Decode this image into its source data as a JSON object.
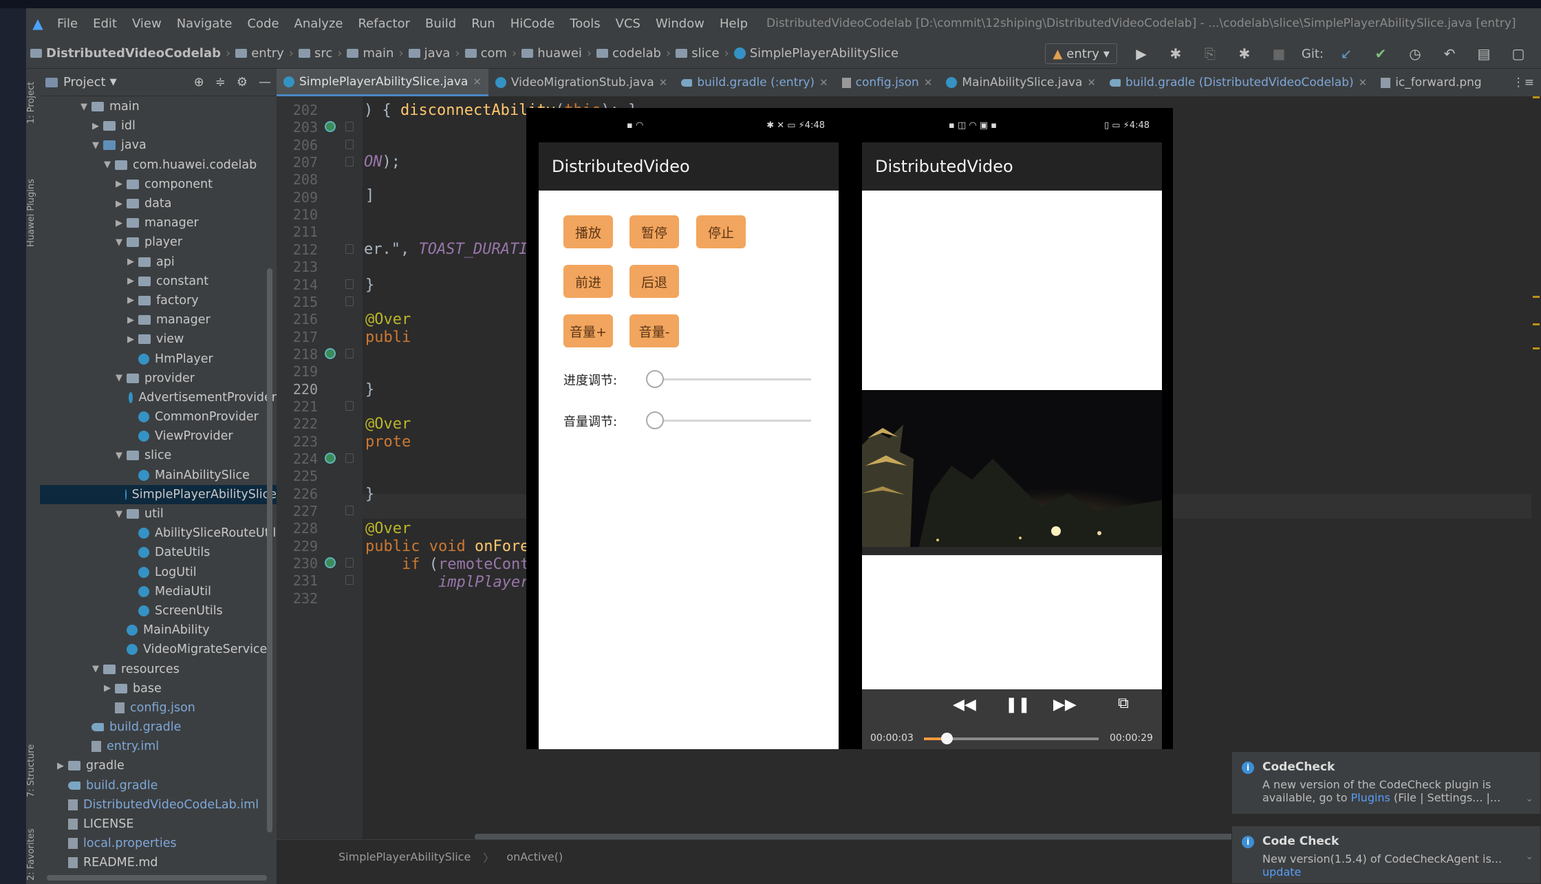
{
  "menubar": {
    "items": [
      "File",
      "Edit",
      "View",
      "Navigate",
      "Code",
      "Analyze",
      "Refactor",
      "Build",
      "Run",
      "HiCode",
      "Tools",
      "VCS",
      "Window",
      "Help"
    ],
    "window_title": "DistributedVideoCodelab [D:\\commit\\12shiping\\DistributedVideoCodelab] - ...\\codelab\\slice\\SimplePlayerAbilitySlice.java [entry]"
  },
  "breadcrumbs": [
    "DistributedVideoCodelab",
    "entry",
    "src",
    "main",
    "java",
    "com",
    "huawei",
    "codelab",
    "slice",
    "SimplePlayerAbilitySlice"
  ],
  "toolbar": {
    "run_config": "entry",
    "git_label": "Git:"
  },
  "left_toolwindow": {
    "project": "1: Project",
    "plugins": "Huawei Plugins",
    "structure": "7: Structure",
    "favorites": "2: Favorites"
  },
  "project_panel": {
    "title": "Project",
    "tree": [
      {
        "label": "main",
        "depth": 3,
        "type": "folder",
        "expanded": true
      },
      {
        "label": "idl",
        "depth": 4,
        "type": "folder",
        "expanded": false
      },
      {
        "label": "java",
        "depth": 4,
        "type": "folder-blue",
        "expanded": true
      },
      {
        "label": "com.huawei.codelab",
        "depth": 5,
        "type": "folder",
        "expanded": true
      },
      {
        "label": "component",
        "depth": 6,
        "type": "folder",
        "expanded": false
      },
      {
        "label": "data",
        "depth": 6,
        "type": "folder",
        "expanded": false
      },
      {
        "label": "manager",
        "depth": 6,
        "type": "folder",
        "expanded": false
      },
      {
        "label": "player",
        "depth": 6,
        "type": "folder",
        "expanded": true
      },
      {
        "label": "api",
        "depth": 7,
        "type": "folder",
        "expanded": false
      },
      {
        "label": "constant",
        "depth": 7,
        "type": "folder",
        "expanded": false
      },
      {
        "label": "factory",
        "depth": 7,
        "type": "folder",
        "expanded": false
      },
      {
        "label": "manager",
        "depth": 7,
        "type": "folder",
        "expanded": false
      },
      {
        "label": "view",
        "depth": 7,
        "type": "folder",
        "expanded": false
      },
      {
        "label": "HmPlayer",
        "depth": 7,
        "type": "class"
      },
      {
        "label": "provider",
        "depth": 6,
        "type": "folder",
        "expanded": true
      },
      {
        "label": "AdvertisementProvider",
        "depth": 7,
        "type": "class"
      },
      {
        "label": "CommonProvider",
        "depth": 7,
        "type": "class"
      },
      {
        "label": "ViewProvider",
        "depth": 7,
        "type": "class"
      },
      {
        "label": "slice",
        "depth": 6,
        "type": "folder",
        "expanded": true
      },
      {
        "label": "MainAbilitySlice",
        "depth": 7,
        "type": "class"
      },
      {
        "label": "SimplePlayerAbilitySlice",
        "depth": 7,
        "type": "class",
        "selected": true
      },
      {
        "label": "util",
        "depth": 6,
        "type": "folder",
        "expanded": true
      },
      {
        "label": "AbilitySliceRouteUtil",
        "depth": 7,
        "type": "class"
      },
      {
        "label": "DateUtils",
        "depth": 7,
        "type": "class"
      },
      {
        "label": "LogUtil",
        "depth": 7,
        "type": "class"
      },
      {
        "label": "MediaUtil",
        "depth": 7,
        "type": "class"
      },
      {
        "label": "ScreenUtils",
        "depth": 7,
        "type": "class"
      },
      {
        "label": "MainAbility",
        "depth": 6,
        "type": "class"
      },
      {
        "label": "VideoMigrateService",
        "depth": 6,
        "type": "class"
      },
      {
        "label": "resources",
        "depth": 4,
        "type": "folder",
        "expanded": true
      },
      {
        "label": "base",
        "depth": 5,
        "type": "folder",
        "expanded": false
      },
      {
        "label": "config.json",
        "depth": 5,
        "type": "file",
        "blue": true
      },
      {
        "label": "build.gradle",
        "depth": 3,
        "type": "gradle",
        "blue": true
      },
      {
        "label": "entry.iml",
        "depth": 3,
        "type": "file",
        "blue": true
      },
      {
        "label": "gradle",
        "depth": 1,
        "type": "folder",
        "expanded": false
      },
      {
        "label": "build.gradle",
        "depth": 1,
        "type": "gradle",
        "blue": true
      },
      {
        "label": "DistributedVideoCodeLab.iml",
        "depth": 1,
        "type": "file",
        "blue": true
      },
      {
        "label": "LICENSE",
        "depth": 1,
        "type": "file"
      },
      {
        "label": "local.properties",
        "depth": 1,
        "type": "file",
        "blue": true
      },
      {
        "label": "README.md",
        "depth": 1,
        "type": "file"
      }
    ]
  },
  "tabs": [
    {
      "label": "SimplePlayerAbilitySlice.java",
      "icon": "class",
      "active": true
    },
    {
      "label": "VideoMigrationStub.java",
      "icon": "class"
    },
    {
      "label": "build.gradle (:entry)",
      "icon": "gradle",
      "colored": true
    },
    {
      "label": "config.json",
      "icon": "json",
      "colored": true
    },
    {
      "label": "MainAbilitySlice.java",
      "icon": "class"
    },
    {
      "label": "build.gradle (DistributedVideoCodelab)",
      "icon": "gradle",
      "colored": true
    },
    {
      "label": "ic_forward.png",
      "icon": "png"
    }
  ],
  "gutter_lines": [
    "202",
    "203",
    "206",
    "207",
    "208",
    "209",
    "210",
    "211",
    "212",
    "213",
    "214",
    "215",
    "216",
    "217",
    "218",
    "219",
    "220",
    "221",
    "222",
    "223",
    "224",
    "225",
    "226",
    "227",
    "228",
    "229",
    "230",
    "231",
    "232"
  ],
  "current_line": "220",
  "code": {
    "l203_tail": ") { disconnectAbility(this); }",
    "l208_tail": "ON);",
    "l213_tail": "er.\", TOAST_DURATION);",
    "l215": "}",
    "l217": "@Over",
    "l218": "publi",
    "l221": "}",
    "l223": "@Over",
    "l224": "prote",
    "l227": "}",
    "l229": "@Over",
    "l230": "public void onForeground(Intent intent) {",
    "l231": "    if (remoteController == null || !remoteController.isShown()) {",
    "l232": "        implPlayer.getLifecycle().onForeground();"
  },
  "statusbar": {
    "class": "SimplePlayerAbilitySlice",
    "method": "onActive()"
  },
  "phone_left": {
    "status_time": "4:48",
    "app_title": "DistributedVideo",
    "buttons": [
      "播放",
      "暂停",
      "停止",
      "前进",
      "后退",
      "音量+",
      "音量-"
    ],
    "progress_label": "进度调节:",
    "volume_label": "音量调节:"
  },
  "phone_right": {
    "status_time": "4:48",
    "app_title": "DistributedVideo",
    "current_time": "00:00:03",
    "total_time": "00:00:29",
    "playback_progress": 0.13
  },
  "notifications": [
    {
      "title": "CodeCheck",
      "text_a": "A new version of the CodeCheck plugin is available, go to ",
      "link": "Plugins",
      "text_b": " (File | Settings... |..."
    },
    {
      "title": "Code Check",
      "text_a": "New version(1.5.4) of CodeCheckAgent is...",
      "link": "update"
    }
  ]
}
